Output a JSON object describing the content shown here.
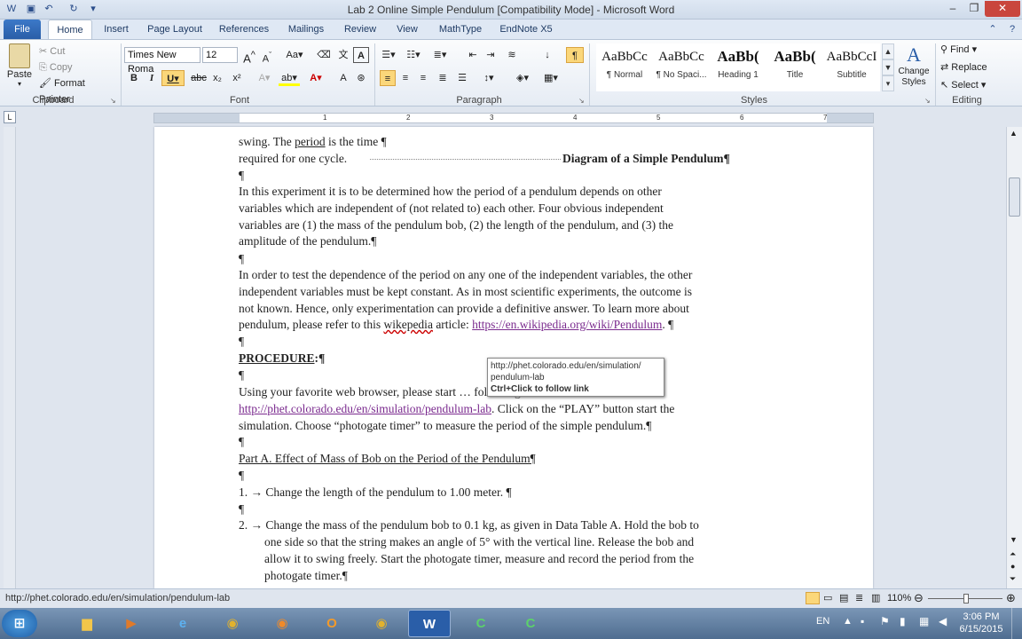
{
  "window": {
    "title": "Lab 2 Online Simple Pendulum [Compatibility Mode]  -  Microsoft Word"
  },
  "tabs": [
    {
      "label": "File"
    },
    {
      "label": "Home"
    },
    {
      "label": "Insert"
    },
    {
      "label": "Page Layout"
    },
    {
      "label": "References"
    },
    {
      "label": "Mailings"
    },
    {
      "label": "Review"
    },
    {
      "label": "View"
    },
    {
      "label": "MathType"
    },
    {
      "label": "EndNote X5"
    }
  ],
  "clipboard": {
    "paste": "Paste",
    "cut": "Cut",
    "copy": "Copy",
    "format_painter": "Format Painter",
    "label": "Clipboard"
  },
  "font": {
    "name": "Times New Roma",
    "size": "12",
    "label": "Font"
  },
  "paragraph": {
    "label": "Paragraph"
  },
  "styles": {
    "items": [
      {
        "preview": "AaBbCc",
        "label": "¶ Normal"
      },
      {
        "preview": "AaBbCc",
        "label": "¶ No Spaci..."
      },
      {
        "preview": "AaBb(",
        "label": "Heading 1"
      },
      {
        "preview": "AaBb(",
        "label": "Title"
      },
      {
        "preview": "AaBbCcI",
        "label": "Subtitle"
      }
    ],
    "change_styles": "Change Styles",
    "label": "Styles"
  },
  "editing": {
    "find": "Find",
    "replace": "Replace",
    "select": "Select",
    "label": "Editing"
  },
  "ruler": {
    "ticks": [
      "1",
      "2",
      "3",
      "4",
      "5",
      "6",
      "7"
    ]
  },
  "document": {
    "line1": "swing.  The ",
    "line1_period": "period",
    "line1_end": " is the time ¶",
    "line2": "required for one cycle.",
    "line2_heading": "Diagram of a Simple Pendulum¶",
    "pilcrow": "¶",
    "p1": [
      "In this experiment it is to be determined how the period of a pendulum depends on other",
      "variables which are independent of (not related to) each other.  Four obvious independent",
      "variables are (1) the mass of the pendulum bob, (2) the length of the pendulum, and (3) the",
      "amplitude of the pendulum.¶"
    ],
    "p2": [
      "In order to test the dependence of the period on any one of the independent variables, the other",
      "independent variables must be kept constant.  As in most scientific experiments, the outcome is",
      "not known.  Hence, only experimentation can provide a definitive answer.  To learn more about"
    ],
    "p2_last_pre": "pendulum, please refer to this ",
    "p2_wikipedia": "wikepedia",
    "p2_article": " article: ",
    "p2_link": "https://en.wikipedia.org/wiki/Pendulum",
    "p2_end": ".  ¶",
    "procedure": "PROCEDURE",
    "procedure_end": ":¶",
    "p3_line1": "Using your favorite web browser, please start … following URL:",
    "p3_link": "http://phet.colorado.edu/en/simulation/pendulum-lab",
    "p3_line2_end": ".  Click on the “PLAY” button start the",
    "p3_line3": "simulation.  Choose “photogate timer” to measure the period of the simple pendulum.¶",
    "part_a": "Part A.  Effect of Mass of Bob on the Period of the Pendulum¶",
    "item1_num": "1.",
    "item1": "Change the length of the pendulum to 1.00 meter.  ¶",
    "item2_num": "2.",
    "item2": [
      "Change the mass of the pendulum bob to 0.1 kg, as given in Data Table A.  Hold the bob to",
      "one side so that the string makes an angle of 5° with the vertical line.  Release the bob and",
      "allow it to swing freely. Start the photogate timer, measure and record the period from the",
      "photogate timer.¶"
    ]
  },
  "tooltip": {
    "url_line1": "http://phet.colorado.edu/en/simulation/",
    "url_line2": "pendulum-lab",
    "hint": "Ctrl+Click to follow link"
  },
  "statusbar": {
    "url": "http://phet.colorado.edu/en/simulation/pendulum-lab",
    "zoom": "110%"
  },
  "taskbar": {
    "lang": "EN",
    "time": "3:06 PM",
    "date": "6/15/2015"
  }
}
